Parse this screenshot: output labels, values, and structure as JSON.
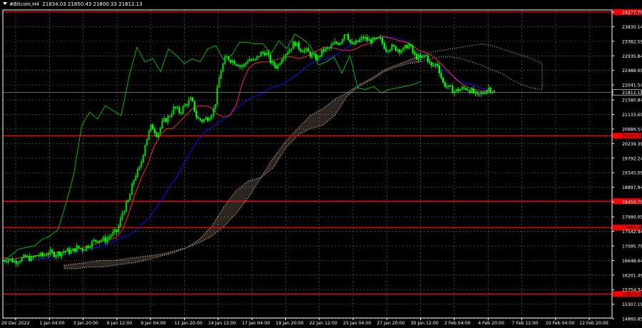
{
  "header": {
    "symbol_tf": "#Bitcoin,H4",
    "ohlc": "21834.03 21850.43 21800.33 21812.13"
  },
  "colors": {
    "background": "#000000",
    "grid": "#6e6e6e",
    "axis": "#ffffff",
    "level": "#ff0000",
    "level_label_bg": "#ff0000",
    "candle": "#00ff00",
    "tenkan": "#ff2a2a",
    "kijun": "#1010ff",
    "chikou": "#00cc00",
    "cloud": "#f4c7a8",
    "cloud_late": "#e0e0e0",
    "price_tag_bg": "#000000"
  },
  "chart_data": {
    "type": "line",
    "title": "",
    "xlabel": "",
    "ylabel": "",
    "ylim": [
      14660.85,
      24277.79
    ],
    "y_ticks": [
      "24277.79",
      "23830.14",
      "23382.59",
      "22935.84",
      "22488.69",
      "22041.54",
      "21580.84",
      "21133.69",
      "20686.54",
      "20239.39",
      "19792.24",
      "19345.09",
      "18897.94",
      "18450.79",
      "17990.09",
      "17542.94",
      "17095.79",
      "16648.64",
      "16201.49",
      "15754.34",
      "15307.19",
      "14860.85"
    ],
    "x_ticks": [
      "29 Dec 2022",
      "1 Jan 04:00",
      "3 Jan 20:00",
      "6 Jan 12:00",
      "9 Jan 04:00",
      "11 Jan 20:00",
      "14 Jan 12:00",
      "17 Jan 04:00",
      "19 Jan 20:00",
      "22 Jan 12:00",
      "25 Jan 04:00",
      "27 Jan 20:00",
      "30 Jan 12:00",
      "2 Feb 04:00",
      "4 Feb 20:00",
      "7 Feb 12:00",
      "10 Feb 04:00",
      "12 Feb 20:00"
    ],
    "last_price": "21812.13",
    "levels": [
      {
        "value": 24280,
        "label": "24280.00"
      },
      {
        "value": 20480,
        "label": "20480.00"
      },
      {
        "value": 18470,
        "label": "18470.00"
      },
      {
        "value": 17660,
        "label": "17660.00"
      },
      {
        "value": 15620,
        "label": "15620.00"
      }
    ],
    "price_path": [
      16650,
      16700,
      16620,
      16680,
      16750,
      16700,
      16820,
      16790,
      16900,
      16850,
      16880,
      16950,
      16920,
      17050,
      17000,
      17120,
      17250,
      17300,
      17280,
      17450,
      17550,
      18150,
      18500,
      19200,
      19500,
      20300,
      20800,
      20500,
      20900,
      21050,
      21350,
      21200,
      21450,
      21600,
      21000,
      20950,
      21050,
      21300,
      22400,
      22900,
      22800,
      22700,
      22600,
      22850,
      22750,
      23000,
      23050,
      22700,
      22600,
      22950,
      23100,
      23350,
      23150,
      23100,
      22950,
      22850,
      23100,
      23150,
      23300,
      23350,
      23700,
      23250,
      23350,
      23500,
      23400,
      23400,
      23450,
      23150,
      23200,
      23150,
      23100,
      23300,
      22950,
      22850,
      22950,
      22600,
      22700,
      22100,
      21950,
      21850,
      21900,
      21950,
      21850,
      21700,
      21800,
      21950,
      21810
    ],
    "tenkan_path": [
      16750,
      16700,
      16700,
      16750,
      16780,
      16780,
      16820,
      16860,
      16880,
      16900,
      16920,
      16960,
      17000,
      17050,
      17100,
      17200,
      17250,
      17300,
      17350,
      17600,
      18100,
      18700,
      19200,
      19600,
      20150,
      20500,
      20700,
      20700,
      20900,
      21100,
      21300,
      21400,
      21400,
      21350,
      21150,
      21050,
      21100,
      21400,
      22100,
      22550,
      22700,
      22750,
      22750,
      22800,
      22850,
      22900,
      22900,
      22850,
      22900,
      23000,
      23100,
      23200,
      23200,
      23150,
      23100,
      23100,
      23150,
      23250,
      23300,
      23450,
      23550,
      23500,
      23450,
      23400,
      23350,
      23250,
      23100,
      23050,
      22950,
      22800,
      22600,
      22400,
      22200,
      22050,
      21950,
      21900,
      21850,
      21850,
      21850
    ],
    "kijun_path": [
      16650,
      16650,
      16650,
      16650,
      16650,
      16700,
      16700,
      16750,
      16800,
      16850,
      16900,
      16950,
      17000,
      17050,
      17100,
      17200,
      17300,
      17400,
      17500,
      17700,
      17900,
      18200,
      18500,
      18900,
      19200,
      19600,
      20000,
      20350,
      20600,
      20750,
      20900,
      21050,
      21250,
      21450,
      21600,
      21700,
      21800,
      21950,
      22000,
      22100,
      22250,
      22400,
      22600,
      22750,
      22800,
      22850,
      22950,
      23100,
      23250,
      23350,
      23400,
      23450,
      23500,
      23500,
      23500,
      23450,
      23350,
      23200,
      23000,
      22800,
      22600,
      22500,
      22350,
      22200,
      22100,
      22050,
      21950,
      21900,
      21850
    ],
    "chikou_path": [
      16650,
      16800,
      17000,
      17050,
      17100,
      17300,
      17400,
      17600,
      18400,
      19300,
      20800,
      21200,
      21000,
      21400,
      21250,
      21100,
      22300,
      23200,
      22750,
      22850,
      22450,
      23150,
      22950,
      22700,
      22850,
      22750,
      23150,
      23250,
      22800,
      22950,
      23350,
      23350,
      23300,
      23300,
      23000,
      23400,
      23150,
      23600,
      23450,
      23250,
      22650,
      22750,
      22900,
      22400,
      22950,
      21950,
      21900,
      22000,
      21800,
      21900,
      21950,
      22000,
      22050,
      22150
    ]
  }
}
